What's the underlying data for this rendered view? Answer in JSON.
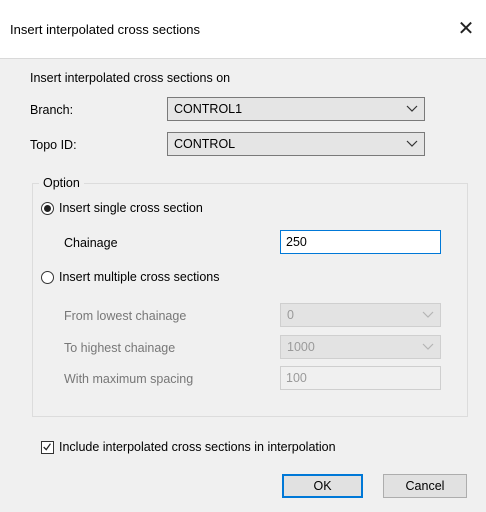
{
  "window": {
    "title": "Insert interpolated cross sections",
    "close_icon": "close-icon"
  },
  "header": {
    "insert_on_label": "Insert interpolated cross sections on"
  },
  "branch": {
    "label": "Branch:",
    "value": "CONTROL1"
  },
  "topo": {
    "label": "Topo ID:",
    "value": "CONTROL"
  },
  "option": {
    "group_title": "Option",
    "single_label": "Insert single cross section",
    "single_selected": true,
    "chainage_label": "Chainage",
    "chainage_value": "250",
    "multiple_label": "Insert multiple cross sections",
    "multiple_selected": false,
    "from_label": "From lowest chainage",
    "from_value": "0",
    "to_label": "To highest chainage",
    "to_value": "1000",
    "spacing_label": "With maximum spacing",
    "spacing_value": "100"
  },
  "include": {
    "label": "Include interpolated cross sections in interpolation",
    "checked": true
  },
  "buttons": {
    "ok_label": "OK",
    "cancel_label": "Cancel"
  }
}
